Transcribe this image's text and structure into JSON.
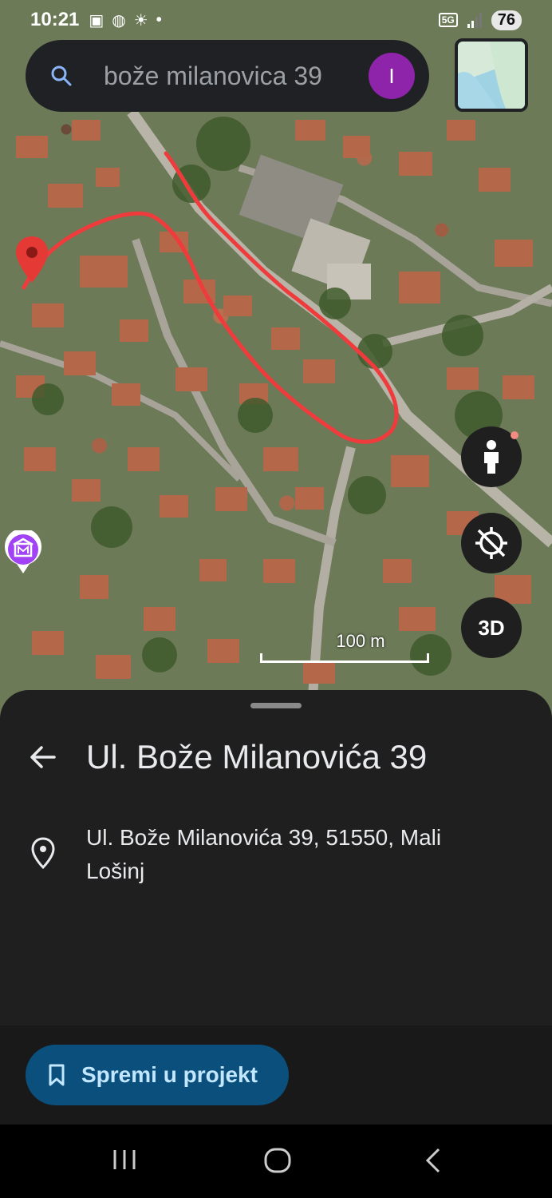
{
  "status_bar": {
    "time": "10:21",
    "icons_left": [
      "screenshot-icon",
      "messenger-icon",
      "brightness-icon",
      "dot"
    ],
    "network": "5G",
    "battery": "76"
  },
  "search": {
    "query": "bože milanovica 39",
    "avatar_letter": "I"
  },
  "map": {
    "scale_label": "100 m",
    "btn_3d": "3D",
    "route_color": "#ef3b3b"
  },
  "place": {
    "title": "Ul. Bože Milanovića 39",
    "address": "Ul. Bože Milanovića 39, 51550, Mali Lošinj"
  },
  "actions": {
    "save_label": "Spremi u projekt"
  },
  "colors": {
    "accent": "#8e24aa",
    "save_button_bg": "#0b4f7c",
    "save_button_text": "#c2e7ff",
    "sheet_bg": "#1f1f1f"
  }
}
